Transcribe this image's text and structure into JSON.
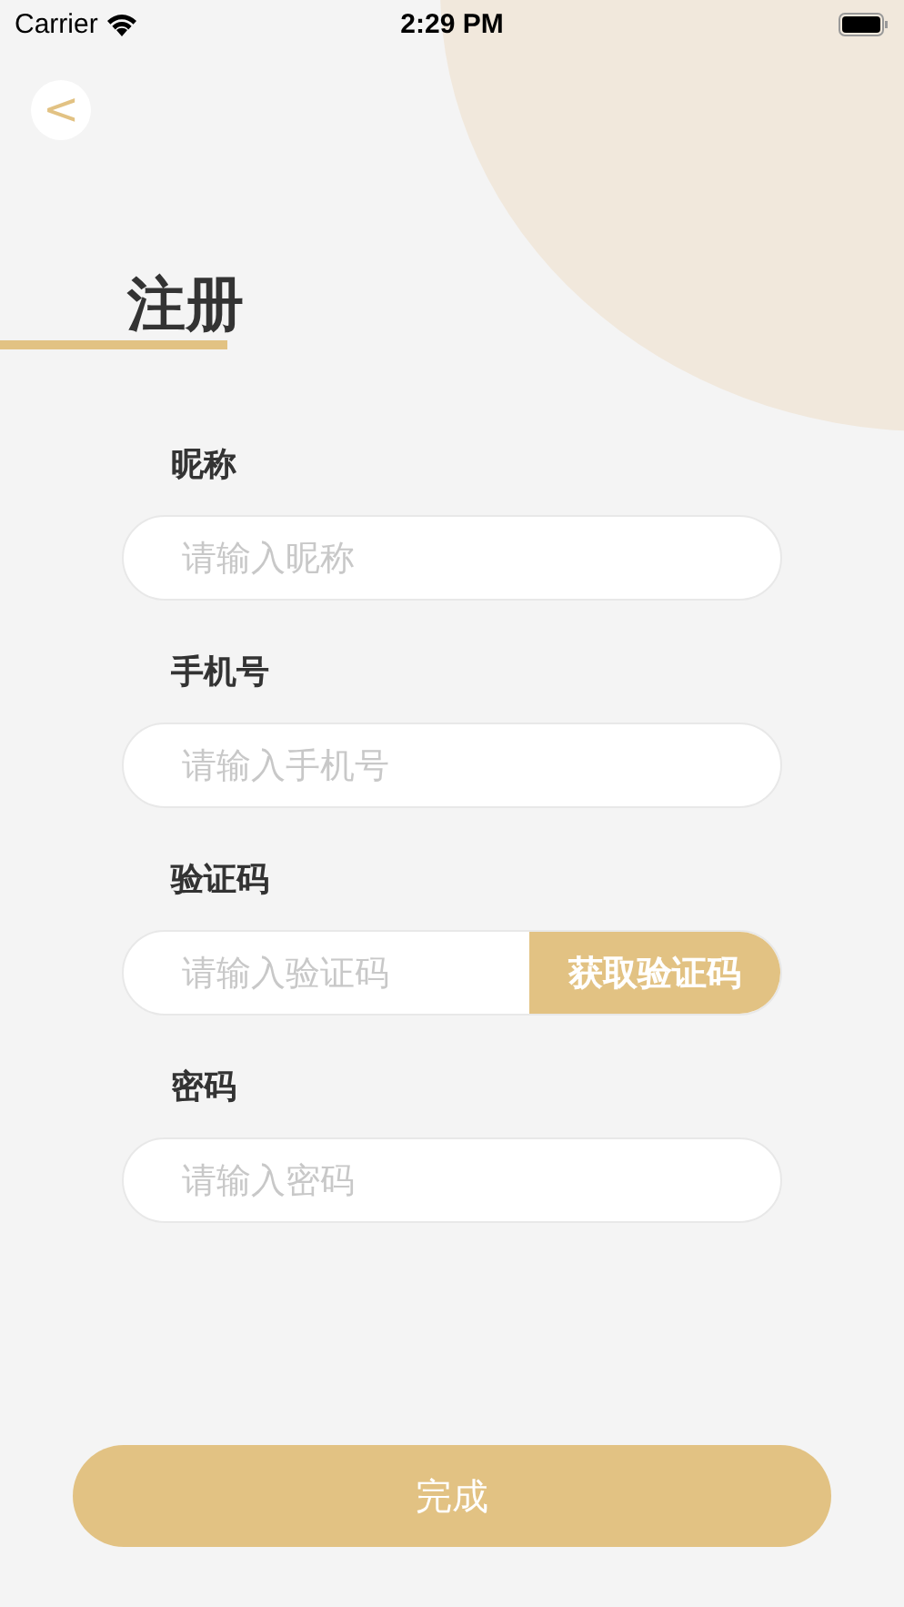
{
  "status_bar": {
    "carrier": "Carrier",
    "time": "2:29 PM"
  },
  "back_button": {
    "label": "<"
  },
  "title": "注册",
  "fields": [
    {
      "kind": "text",
      "label": "昵称",
      "placeholder": "请输入昵称"
    },
    {
      "kind": "text",
      "label": "手机号",
      "placeholder": "请输入手机号"
    },
    {
      "kind": "code",
      "label": "验证码",
      "placeholder": "请输入验证码",
      "button": "获取验证码"
    },
    {
      "kind": "password",
      "label": "密码",
      "placeholder": "请输入密码"
    }
  ],
  "submit": "完成"
}
